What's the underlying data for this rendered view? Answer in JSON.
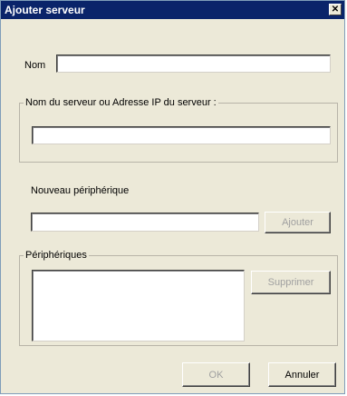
{
  "window": {
    "title": "Ajouter serveur",
    "close_glyph": "✕"
  },
  "fields": {
    "nom_label": "Nom",
    "nom_value": "",
    "server_group_label": "Nom du serveur ou Adresse IP du serveur :",
    "server_value": "",
    "new_device_label": "Nouveau périphérique",
    "new_device_value": ""
  },
  "devices": {
    "group_label": "Périphériques",
    "items": []
  },
  "buttons": {
    "add": "Ajouter",
    "remove": "Supprimer",
    "ok": "OK",
    "cancel": "Annuler"
  }
}
